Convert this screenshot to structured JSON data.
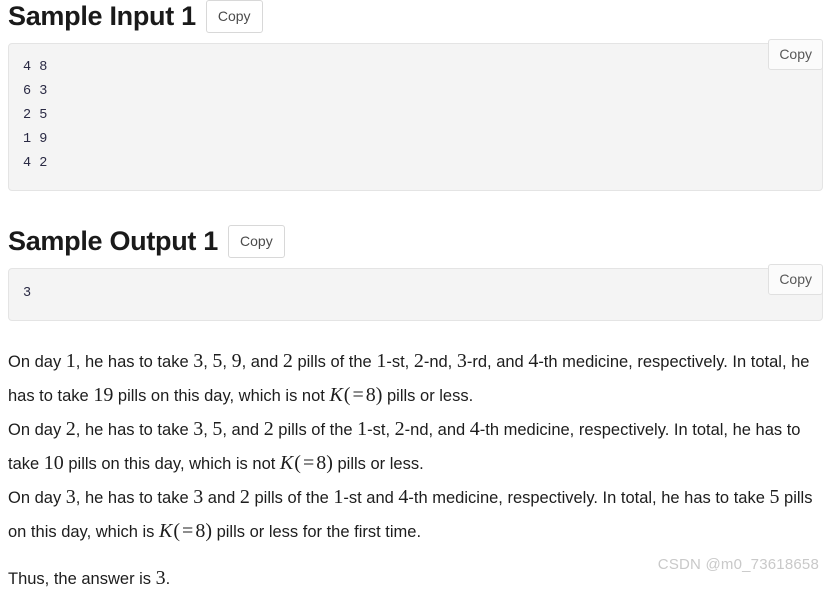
{
  "sample_input": {
    "title": "Sample Input 1",
    "copy_label": "Copy",
    "inner_copy_label": "Copy",
    "content": "4 8\n6 3\n2 5\n1 9\n4 2"
  },
  "sample_output": {
    "title": "Sample Output 1",
    "copy_label": "Copy",
    "inner_copy_label": "Copy",
    "content": "3"
  },
  "explanation": {
    "p1": {
      "s1": "On day ",
      "m1": "1",
      "s2": ", he has to take ",
      "m2": "3",
      "s3": ", ",
      "m3": "5",
      "s4": ", ",
      "m4": "9",
      "s5": ", and ",
      "m5": "2",
      "s6": " pills of the ",
      "m6": "1",
      "s7": "-st, ",
      "m7": "2",
      "s8": "-nd, ",
      "m8": "3",
      "s9": "-rd, and ",
      "m9": "4",
      "s10": "-th medicine, respectively. In total, he has to take ",
      "m10": "19",
      "s11": " pills on this day, which is not ",
      "mk_var": "K",
      "mk_open": "(",
      "mk_eq": "=",
      "mk_val": "8",
      "mk_close": ")",
      "s12": " pills or less."
    },
    "p2": {
      "s1": "On day ",
      "m1": "2",
      "s2": ", he has to take ",
      "m2": "3",
      "s3": ", ",
      "m3": "5",
      "s4": ", and ",
      "m4": "2",
      "s5": " pills of the ",
      "m5": "1",
      "s6": "-st, ",
      "m6": "2",
      "s7": "-nd, and ",
      "m7": "4",
      "s8": "-th medicine, respectively. In total, he has to take ",
      "m8": "10",
      "s9": " pills on this day, which is not ",
      "mk_var": "K",
      "mk_open": "(",
      "mk_eq": "=",
      "mk_val": "8",
      "mk_close": ")",
      "s10": " pills or less."
    },
    "p3": {
      "s1": "On day ",
      "m1": "3",
      "s2": ", he has to take ",
      "m2": "3",
      "s3": " and ",
      "m3": "2",
      "s4": " pills of the ",
      "m4": "1",
      "s5": "-st and ",
      "m5": "4",
      "s6": "-th medicine, respectively. In total, he has to take ",
      "m6": "5",
      "s7": " pills on this day, which is ",
      "mk_var": "K",
      "mk_open": "(",
      "mk_eq": "=",
      "mk_val": "8",
      "mk_close": ")",
      "s8": " pills or less for the first time."
    },
    "p4": {
      "s1": "Thus, the answer is ",
      "m1": "3",
      "s2": "."
    }
  },
  "watermark": {
    "text": "CSDN @m0_73618658"
  }
}
